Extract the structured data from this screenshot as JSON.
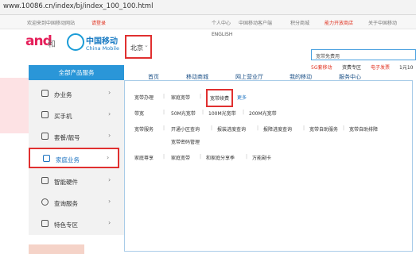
{
  "url": "www.10086.cn/index/bj/index_100_100.html",
  "topbar": {
    "welcome": "欢迎来到中国移动网站",
    "login": "请登录",
    "links": [
      "个人中心",
      "中国移动客户端",
      "积分商城",
      "能力开放商店",
      "关于中国移动"
    ]
  },
  "header": {
    "brand_and": "and",
    "brand_he": "和",
    "cm_name": "中国移动",
    "cm_en": "China Mobile",
    "city": "北京",
    "city_arrow": "⌄",
    "english": "ENGLISH",
    "search_text": "宽带免费用",
    "sublinks": [
      "5G套移动",
      "资费专区",
      "电子发票",
      "1元10"
    ]
  },
  "nav": {
    "all_products": "全部产品服务",
    "main_items": [
      "首页",
      "移动商城",
      "网上营业厅",
      "我的移动",
      "服务中心"
    ]
  },
  "menu": [
    {
      "label": "办业务",
      "arrow": "›",
      "icon": "briefcase-icon"
    },
    {
      "label": "买手机",
      "arrow": "›",
      "icon": "phone-icon"
    },
    {
      "label": "套餐/靓号",
      "arrow": "›",
      "icon": "card-icon"
    },
    {
      "label": "家庭业务",
      "arrow": "›",
      "icon": "home-icon",
      "active": true
    },
    {
      "label": "智能硬件",
      "arrow": "›",
      "icon": "device-icon"
    },
    {
      "label": "查询服务",
      "arrow": "›",
      "icon": "search-icon"
    },
    {
      "label": "特色专区",
      "arrow": "›",
      "icon": "star-icon"
    }
  ],
  "panel": {
    "rows": [
      {
        "cat": "宽带办理",
        "links": [
          "家庭宽带",
          "宽带续费",
          "更多"
        ]
      },
      {
        "cat": "带宽",
        "links": [
          "50M光宽带",
          "100M光宽带",
          "200M光宽带"
        ]
      },
      {
        "cat": "宽带服务",
        "links": [
          "开通小区查询",
          "报装进度查询",
          "报障进度查询",
          "宽带自助服务",
          "宽带自助排障",
          "宽带密码管理"
        ]
      },
      {
        "cat": "家庭尊享",
        "links": [
          "家庭宽带",
          "和家庭分享季",
          "万能副卡"
        ]
      }
    ]
  }
}
